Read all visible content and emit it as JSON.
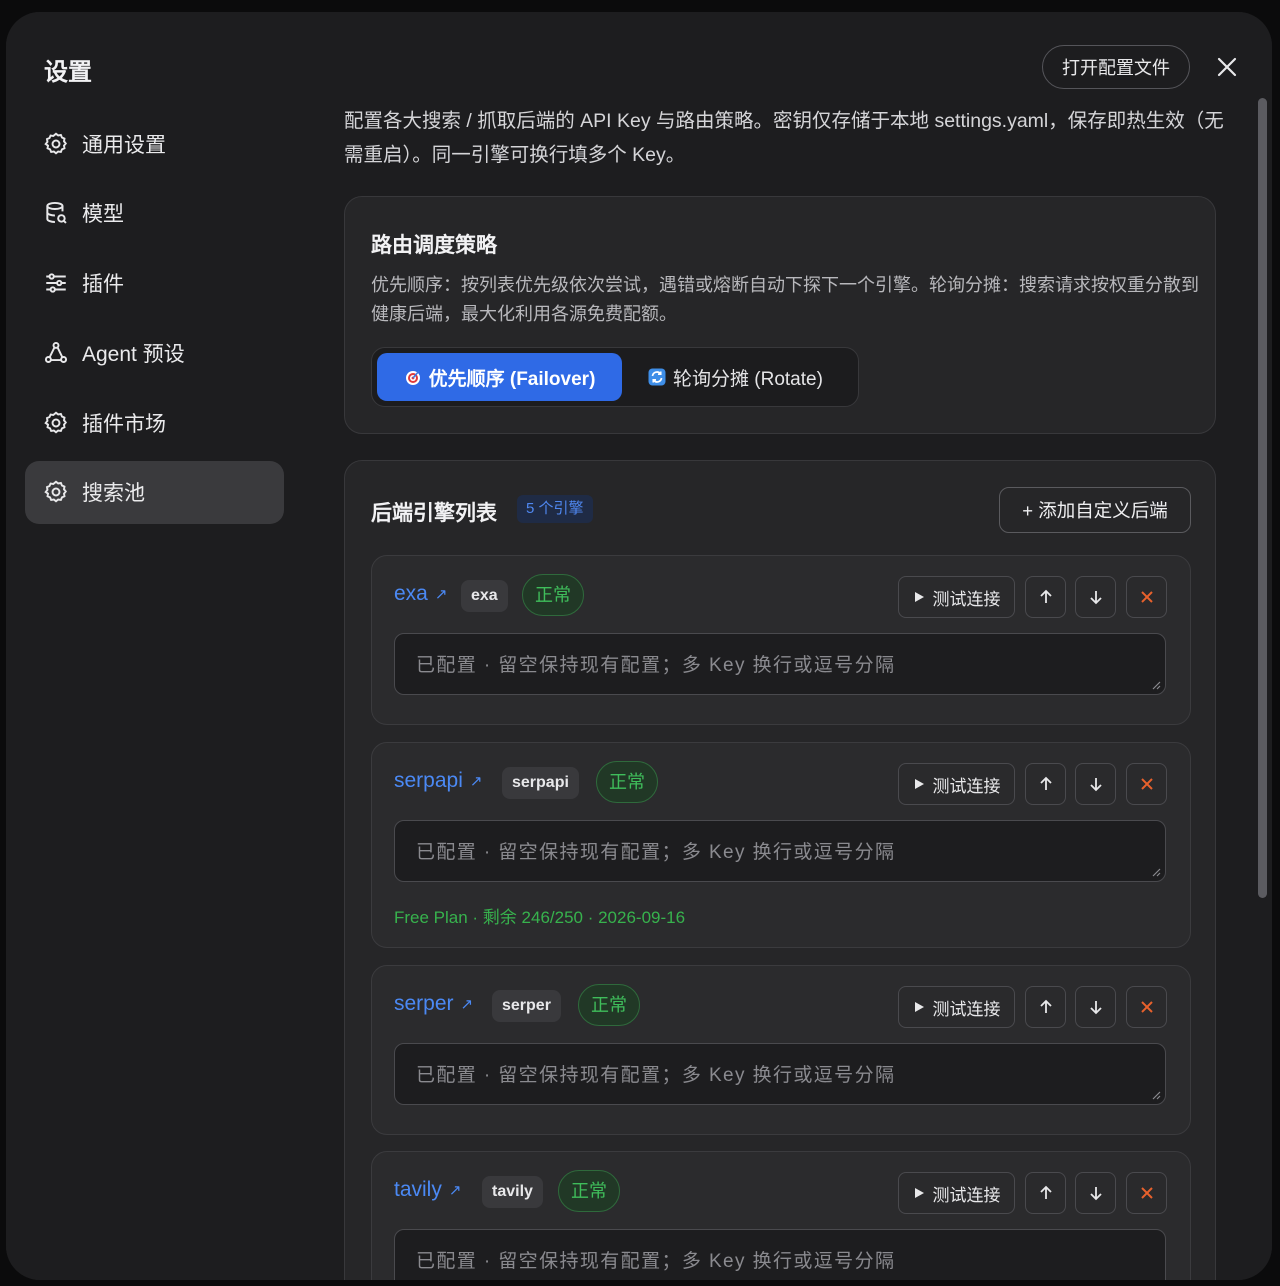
{
  "sidebar": {
    "title": "设置",
    "items": [
      {
        "label": "通用设置",
        "icon": "gear-icon"
      },
      {
        "label": "模型",
        "icon": "database-icon"
      },
      {
        "label": "插件",
        "icon": "sliders-icon"
      },
      {
        "label": "Agent 预设",
        "icon": "agent-icon"
      },
      {
        "label": "插件市场",
        "icon": "gear-icon"
      },
      {
        "label": "搜索池",
        "icon": "gear-icon",
        "active": true
      }
    ]
  },
  "header": {
    "open_config_label": "打开配置文件",
    "description": "配置各大搜索 / 抓取后端的 API Key 与路由策略。密钥仅存储于本地 settings.yaml，保存即热生效（无需重启）。同一引擎可换行填多个 Key。"
  },
  "routing": {
    "title": "路由调度策略",
    "description": "优先顺序：按列表优先级依次尝试，遇错或熔断自动下探下一个引擎。轮询分摊：搜索请求按权重分散到健康后端，最大化利用各源免费配额。",
    "options": [
      {
        "label": "优先顺序 (Failover)",
        "icon": "target-icon",
        "selected": true
      },
      {
        "label": "轮询分摊 (Rotate)",
        "icon": "rotate-icon",
        "selected": false
      }
    ]
  },
  "engines": {
    "title": "后端引擎列表",
    "count_badge": "5 个引擎",
    "add_label": "+ 添加自定义后端",
    "test_label": "测试连接",
    "key_placeholder": "已配置 · 留空保持现有配置；多 Key 换行或逗号分隔",
    "list": [
      {
        "name": "exa",
        "tag": "exa",
        "status": "正常",
        "quota": ""
      },
      {
        "name": "serpapi",
        "tag": "serpapi",
        "status": "正常",
        "quota": "Free Plan · 剩余 246/250 · 2026-09-16"
      },
      {
        "name": "serper",
        "tag": "serper",
        "status": "正常",
        "quota": ""
      },
      {
        "name": "tavily",
        "tag": "tavily",
        "status": "正常",
        "quota": ""
      }
    ]
  },
  "colors": {
    "accent": "#2f6ae6",
    "link": "#4b89f4",
    "ok": "#3fbd5b",
    "danger": "#e8612c"
  }
}
